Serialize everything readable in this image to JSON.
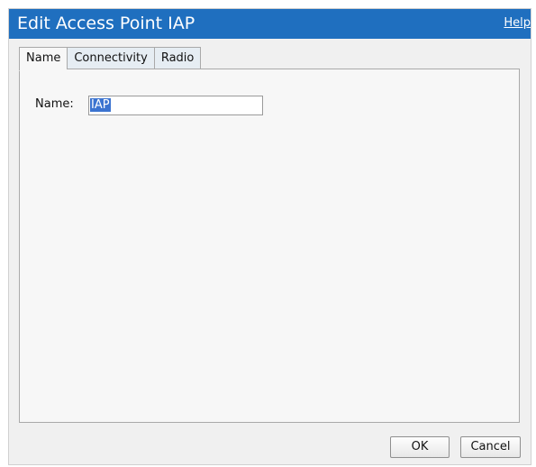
{
  "dialog": {
    "title": "Edit Access Point IAP",
    "help_label": "Help"
  },
  "tabs": [
    {
      "label": "Name",
      "active": true
    },
    {
      "label": "Connectivity",
      "active": false
    },
    {
      "label": "Radio",
      "active": false
    }
  ],
  "form": {
    "name_label": "Name:",
    "name_value": "IAP"
  },
  "buttons": {
    "ok_label": "OK",
    "cancel_label": "Cancel"
  },
  "colors": {
    "titlebar": "#1f6fbf",
    "selection": "#3b73d0"
  }
}
